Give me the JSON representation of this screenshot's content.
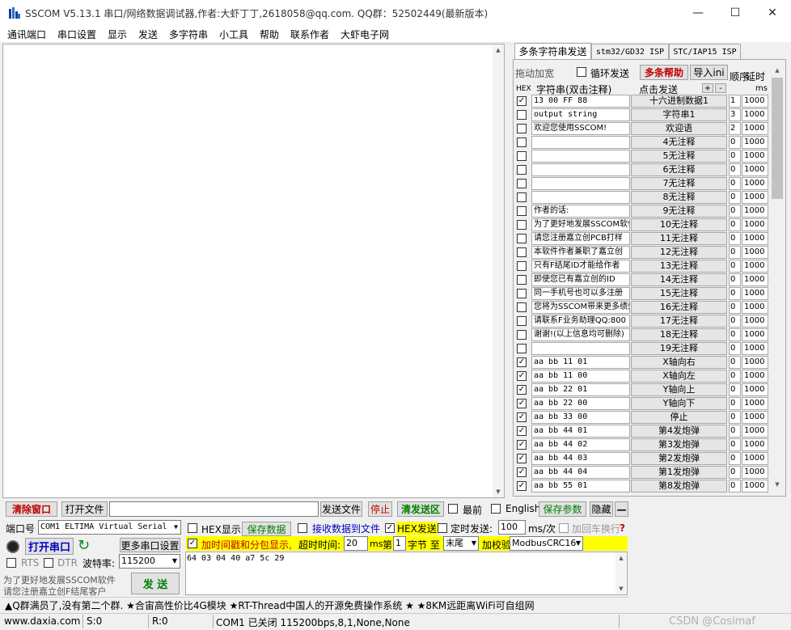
{
  "window": {
    "title": "SSCOM V5.13.1 串口/网络数据调试器,作者:大虾丁丁,2618058@qq.com. QQ群：52502449(最新版本)",
    "minimize": "—",
    "maximize": "☐",
    "close": "✕"
  },
  "menu": [
    "通讯端口",
    "串口设置",
    "显示",
    "发送",
    "多字符串",
    "小工具",
    "帮助",
    "联系作者",
    "大虾电子网"
  ],
  "tabs": [
    "多条字符串发送",
    "stm32/GD32 ISP",
    "STC/IAP15 ISP"
  ],
  "multi": {
    "drag_label": "拖动加宽",
    "loop_label": "循环发送",
    "help_label": "多条帮助",
    "import_label": "导入ini",
    "order_label": "顺序",
    "delay_label": "延时",
    "hex_label": "HEX",
    "str_label": "字符串(双击注释)",
    "click_label": "点击发送",
    "plus": "+",
    "minus": "-",
    "ms_label": "ms",
    "rows": [
      {
        "hex": true,
        "str": "13 00 FF 88",
        "btn": "十六进制数据1",
        "ord": "1",
        "dly": "1000"
      },
      {
        "hex": false,
        "str": "output string",
        "btn": "字符串1",
        "ord": "3",
        "dly": "1000"
      },
      {
        "hex": false,
        "str": "欢迎您使用SSCOM!",
        "btn": "欢迎语",
        "ord": "2",
        "dly": "1000"
      },
      {
        "hex": false,
        "str": "",
        "btn": "4无注释",
        "ord": "0",
        "dly": "1000"
      },
      {
        "hex": false,
        "str": "",
        "btn": "5无注释",
        "ord": "0",
        "dly": "1000"
      },
      {
        "hex": false,
        "str": "",
        "btn": "6无注释",
        "ord": "0",
        "dly": "1000"
      },
      {
        "hex": false,
        "str": "",
        "btn": "7无注释",
        "ord": "0",
        "dly": "1000"
      },
      {
        "hex": false,
        "str": "",
        "btn": "8无注释",
        "ord": "0",
        "dly": "1000"
      },
      {
        "hex": false,
        "str": "作者的话:",
        "btn": "9无注释",
        "ord": "0",
        "dly": "1000"
      },
      {
        "hex": false,
        "str": "为了更好地发展SSCOM软件",
        "btn": "10无注释",
        "ord": "0",
        "dly": "1000"
      },
      {
        "hex": false,
        "str": "请您注册嘉立创PCB打样",
        "btn": "11无注释",
        "ord": "0",
        "dly": "1000"
      },
      {
        "hex": false,
        "str": "本软件作者兼职了嘉立创",
        "btn": "12无注释",
        "ord": "0",
        "dly": "1000"
      },
      {
        "hex": false,
        "str": "只有F结尾ID才能给作者",
        "btn": "13无注释",
        "ord": "0",
        "dly": "1000"
      },
      {
        "hex": false,
        "str": "即使您已有嘉立创的ID",
        "btn": "14无注释",
        "ord": "0",
        "dly": "1000"
      },
      {
        "hex": false,
        "str": "同一手机号也可以多注册",
        "btn": "15无注释",
        "ord": "0",
        "dly": "1000"
      },
      {
        "hex": false,
        "str": "您将为SSCOM带来更多绩效",
        "btn": "16无注释",
        "ord": "0",
        "dly": "1000"
      },
      {
        "hex": false,
        "str": "请联系F业务助理QQ:800",
        "btn": "17无注释",
        "ord": "0",
        "dly": "1000"
      },
      {
        "hex": false,
        "str": "谢谢!(以上信息均可删除)",
        "btn": "18无注释",
        "ord": "0",
        "dly": "1000"
      },
      {
        "hex": false,
        "str": "",
        "btn": "19无注释",
        "ord": "0",
        "dly": "1000"
      },
      {
        "hex": true,
        "str": "aa bb 11 01",
        "btn": "X轴向右",
        "ord": "0",
        "dly": "1000"
      },
      {
        "hex": true,
        "str": "aa bb 11 00",
        "btn": "X轴向左",
        "ord": "0",
        "dly": "1000"
      },
      {
        "hex": true,
        "str": "aa bb 22 01",
        "btn": "Y轴向上",
        "ord": "0",
        "dly": "1000"
      },
      {
        "hex": true,
        "str": "aa bb 22 00",
        "btn": "Y轴向下",
        "ord": "0",
        "dly": "1000"
      },
      {
        "hex": true,
        "str": "aa bb 33 00",
        "btn": "停止",
        "ord": "0",
        "dly": "1000"
      },
      {
        "hex": true,
        "str": "aa bb 44 01",
        "btn": "第4发炮弹",
        "ord": "0",
        "dly": "1000"
      },
      {
        "hex": true,
        "str": "aa bb 44 02",
        "btn": "第3发炮弹",
        "ord": "0",
        "dly": "1000"
      },
      {
        "hex": true,
        "str": "aa bb 44 03",
        "btn": "第2发炮弹",
        "ord": "0",
        "dly": "1000"
      },
      {
        "hex": true,
        "str": "aa bb 44 04",
        "btn": "第1发炮弹",
        "ord": "0",
        "dly": "1000"
      },
      {
        "hex": true,
        "str": "aa bb 55 01",
        "btn": "第8发炮弹",
        "ord": "0",
        "dly": "1000"
      }
    ]
  },
  "toolbar": {
    "clear_window": "清除窗口",
    "open_file": "打开文件",
    "file_path": "",
    "send_file": "发送文件",
    "stop": "停止",
    "clear_send": "清发送区",
    "topmost": "最前",
    "english": "English",
    "save_params": "保存参数",
    "hide": "隐藏",
    "dash": "—"
  },
  "port": {
    "port_label": "端口号",
    "port_value": "COM1 ELTIMA Virtual Serial",
    "open_button": "打开串口",
    "more_settings": "更多串口设置",
    "rts": "RTS",
    "dtr": "DTR",
    "baud_label": "波特率:",
    "baud_value": "115200",
    "promo_line1": "为了更好地发展SSCOM软件",
    "promo_line2": "请您注册嘉立创F结尾客户",
    "send_button": "发 送"
  },
  "options": {
    "hex_display": "HEX显示",
    "save_data": "保存数据",
    "recv_to_file": "接收数据到文件",
    "hex_send": "HEX发送",
    "timed_send": "定时发送:",
    "timed_value": "100",
    "timed_unit": "ms/次",
    "add_crlf": "加回车换行",
    "timestamp": "加时间戳和分包显示,",
    "timeout_label": "超时时间:",
    "timeout_value": "20",
    "timeout_unit": "ms",
    "nth_label": "第",
    "nth_value": "1",
    "byte_label": "字节 至",
    "end_value": "末尾",
    "checksum_label": "加校验",
    "checksum_value": "ModbusCRC16"
  },
  "send_text": "64 03 04 40 a7 5c 29",
  "ad_ticker": "▲Q群满员了,没有第二个群. ★合宙高性价比4G模块 ★RT-Thread中国人的开源免费操作系统 ★ ★8KM远距离WiFi可自组网",
  "status": {
    "site": "www.daxia.com",
    "sent": "S:0",
    "recv": "R:0",
    "port_state": "COM1 已关闭  115200bps,8,1,None,None",
    "watermark": "CSDN @Cosimaf"
  },
  "colors": {
    "highlight_yellow": "#ffff00",
    "accent_red": "#c00000",
    "accent_green": "#008000",
    "accent_blue": "#0000c0"
  }
}
